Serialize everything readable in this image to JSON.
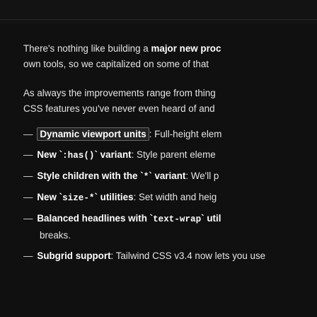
{
  "intro": {
    "part1": "There's nothing like building a ",
    "bold": "major new proc",
    "line2": "own tools, so we capitalized on some of that"
  },
  "para2": {
    "line1": "As always the improvements range from thing",
    "line2": "CSS features you've never even heard of and"
  },
  "features": [
    {
      "bold": "Dynamic viewport units",
      "text": ": Full-height elem"
    },
    {
      "bold_a": "New ",
      "code": ":has()",
      "bold_b": " variant",
      "text": ": Style parent eleme"
    },
    {
      "bold_a": "Style children with the ",
      "code": "*",
      "bold_b": " variant",
      "text": ": We'll p"
    },
    {
      "bold_a": "New ",
      "code": "size-*",
      "bold_b": " utilities",
      "text": ": Set width and heig"
    },
    {
      "bold_a": "Balanced headlines with ",
      "code": "text-wrap",
      "bold_b": " util",
      "cont": "breaks."
    },
    {
      "bold": "Subgrid support",
      "text": ": Tailwind CSS v3.4 now lets you use"
    }
  ]
}
